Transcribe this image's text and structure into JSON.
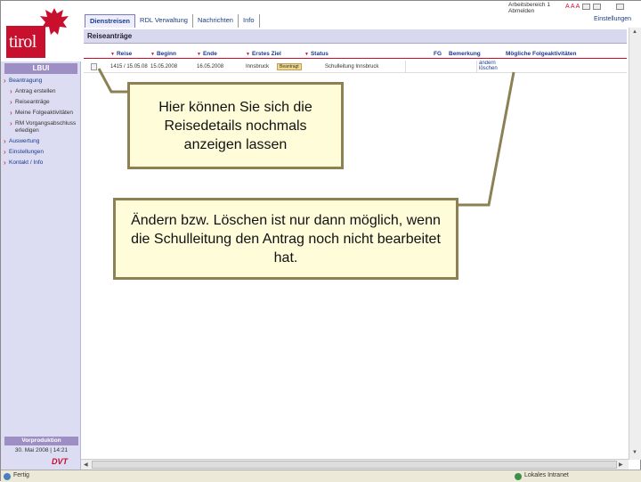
{
  "sidebar": {
    "logo_text": "tirol",
    "section_title": "LBUI",
    "nav_items": [
      {
        "label": "Beantragung",
        "level": "top"
      },
      {
        "label": "Antrag erstellen",
        "level": "sub"
      },
      {
        "label": "Reiseanträge",
        "level": "sub"
      },
      {
        "label": "Meine Folgeaktivitäten",
        "level": "sub"
      },
      {
        "label": "RM Vorgangsabschluss erledigen",
        "level": "sub"
      },
      {
        "label": "Auswertung",
        "level": "top"
      },
      {
        "label": "Einstellungen",
        "level": "top"
      },
      {
        "label": "Kontakt / Info",
        "level": "top"
      }
    ],
    "footer_label": "Vorproduktion",
    "footer_date": "30. Mai 2008 | 14:21",
    "brand": "DVT"
  },
  "header": {
    "tabs": [
      "Dienstreisen",
      "RDL Verwaltung",
      "Nachrichten",
      "Info"
    ],
    "active_tab": 0,
    "user_line1": "Arbeitsbereich 1",
    "user_line2": "Abmelden",
    "font_sizes": "A A A",
    "settings": "Einstellungen"
  },
  "content": {
    "title": "Reiseanträge",
    "columns": [
      "Reise",
      "Beginn",
      "Ende",
      "Erstes Ziel",
      "Status",
      "FG",
      "Bemerkung",
      "Mögliche Folgeaktivitäten"
    ],
    "rows": [
      {
        "reise": "1415 / 15.05.08",
        "beginn": "15.05.2008",
        "ende": "16.05.2008",
        "ziel": "Innsbruck",
        "status": "Beantragt",
        "fg": "Schulleitung Innsbruck",
        "bemerkung": "",
        "actions": [
          "ändern",
          "löschen"
        ]
      }
    ]
  },
  "statusbar": {
    "status": "Fertig",
    "zone": "Lokales Intranet"
  },
  "callouts": {
    "details": "Hier können Sie sich die Reisedetails nochmals anzeigen lassen",
    "edit": "Ändern bzw. Löschen ist nur dann möglich, wenn die Schulleitung den Antrag noch nicht bearbeitet hat."
  },
  "colors": {
    "accent": "#c8102e",
    "sidebar_bg": "#dcdcf2",
    "callout_bg": "#fefcd9",
    "callout_border": "#8c8155"
  }
}
